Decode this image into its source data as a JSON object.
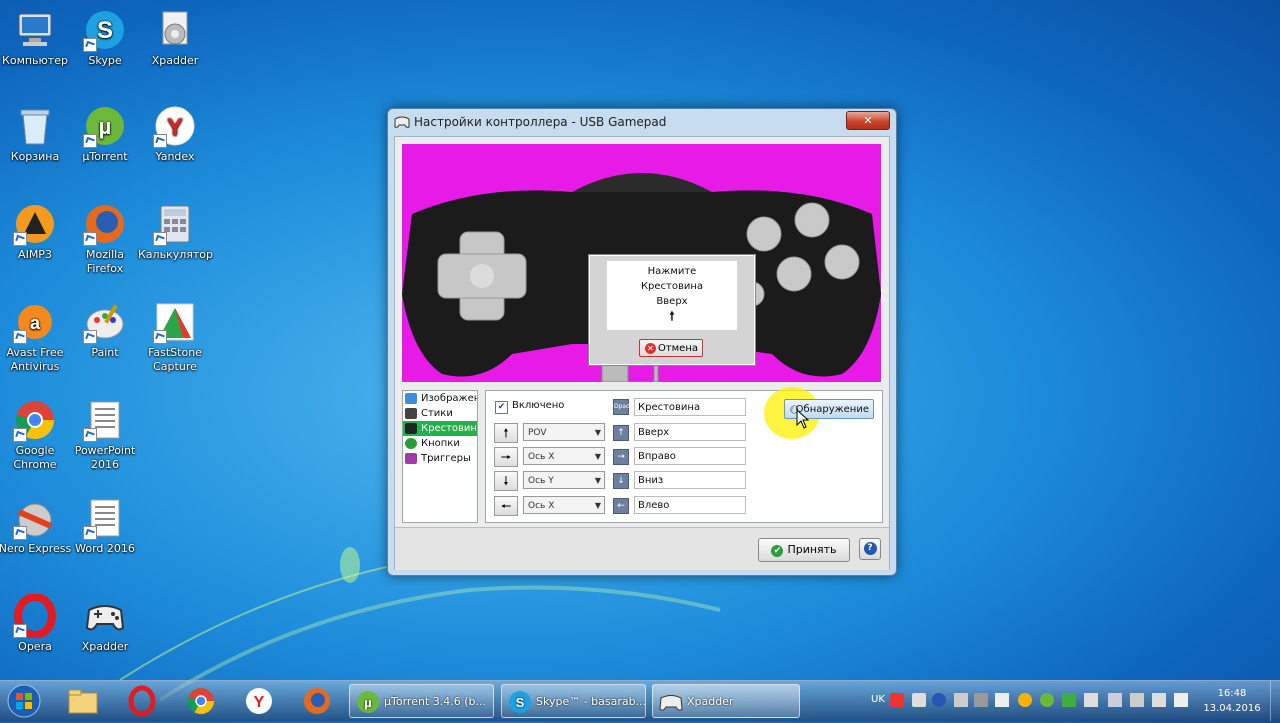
{
  "desktop": {
    "icons": [
      {
        "label": "Компьютер"
      },
      {
        "label": "Skype"
      },
      {
        "label": "Xpadder"
      },
      {
        "label": "Корзина"
      },
      {
        "label": "µTorrent"
      },
      {
        "label": "Yandex"
      },
      {
        "label": "AIMP3"
      },
      {
        "label": "Mozilla Firefox"
      },
      {
        "label": "Калькулятор"
      },
      {
        "label": "Avast Free Antivirus"
      },
      {
        "label": "Paint"
      },
      {
        "label": "FastStone Capture"
      },
      {
        "label": "Google Chrome"
      },
      {
        "label": "PowerPoint 2016"
      },
      {
        "label": "Nero Express"
      },
      {
        "label": "Word 2016"
      },
      {
        "label": "Opera"
      },
      {
        "label": "Xpadder"
      }
    ]
  },
  "window": {
    "title": "Настройки контроллера - USB Gamepad",
    "close_label": "✕",
    "dialog": {
      "line1": "Нажмите",
      "line2": "Крестовина",
      "line3": "Вверх",
      "arrow": "🠕",
      "cancel_label": "Отмена"
    },
    "tree": [
      {
        "label": "Изображен"
      },
      {
        "label": "Стики"
      },
      {
        "label": "Крестовин"
      },
      {
        "label": "Кнопки"
      },
      {
        "label": "Триггеры"
      }
    ],
    "enabled_label": "Включено",
    "enabled_checked": true,
    "detect_label": "Обнаружение",
    "header_field": {
      "icon": "Dpad",
      "value": "Крестовина"
    },
    "rows": [
      {
        "arrow": "🠕",
        "axis": "POV",
        "value": "Вверх",
        "icon": "↑"
      },
      {
        "arrow": "🠖",
        "axis": "Ось X",
        "value": "Вправо",
        "icon": "→"
      },
      {
        "arrow": "🠗",
        "axis": "Ось Y",
        "value": "Вниз",
        "icon": "↓"
      },
      {
        "arrow": "🠔",
        "axis": "Ось X",
        "value": "Влево",
        "icon": "←"
      }
    ],
    "accept_label": "Принять",
    "help_label": "?"
  },
  "taskbar": {
    "tasks": [
      {
        "label": "µTorrent 3.4.6  (b..."
      },
      {
        "label": "Skype™ - basarab..."
      },
      {
        "label": "Xpadder"
      }
    ],
    "language": "UK",
    "time": "16:48",
    "date": "13.04.2016"
  },
  "colors": {
    "pad_background": "#e81ae8",
    "tree_selected": "#22b14c",
    "highlight": "#fff000"
  }
}
